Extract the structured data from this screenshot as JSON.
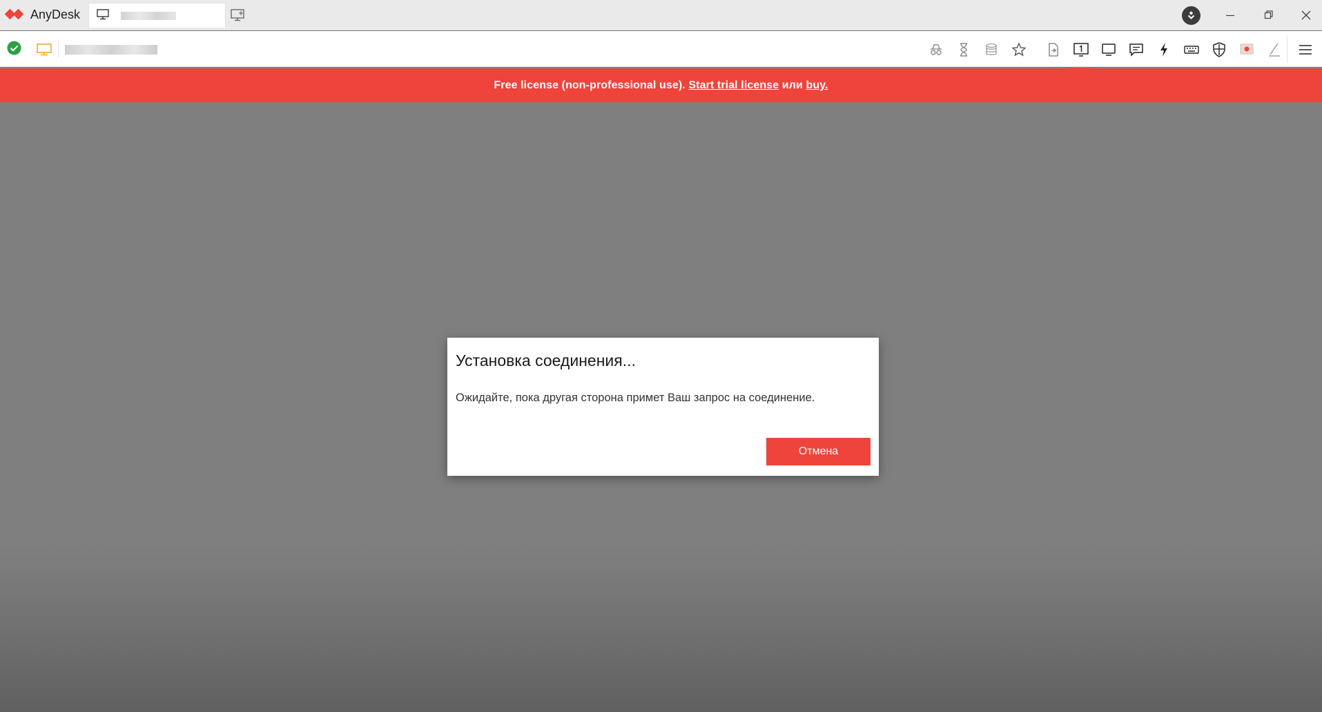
{
  "app": {
    "name": "AnyDesk",
    "brand_color": "#ef443b"
  },
  "titlebar": {
    "tab_icon": "monitor-icon",
    "new_tab_icon": "new-session-icon",
    "update_icon": "download-icon",
    "window_controls": [
      "minimize-icon",
      "restore-icon",
      "close-icon"
    ]
  },
  "toolbar": {
    "status_icon": "connected-check-icon",
    "address_icon": "monitor-icon",
    "tools": [
      "incognito-icon",
      "hourglass-icon",
      "database-icon",
      "star-icon",
      "file-transfer-icon",
      "display-1-icon",
      "display-icon",
      "chat-icon",
      "actions-icon",
      "keyboard-icon",
      "permissions-icon",
      "record-icon",
      "pen-icon",
      "menu-icon"
    ],
    "active_tool": "display-1-icon"
  },
  "banner": {
    "prefix": "Free license (non-professional use). ",
    "trial_link": "Start trial license",
    "middle": " или ",
    "buy_link": "buy."
  },
  "dialog": {
    "title": "Установка соединения...",
    "message": "Ожидайте, пока другая сторона примет Ваш запрос на соединение.",
    "cancel_label": "Отмена"
  }
}
